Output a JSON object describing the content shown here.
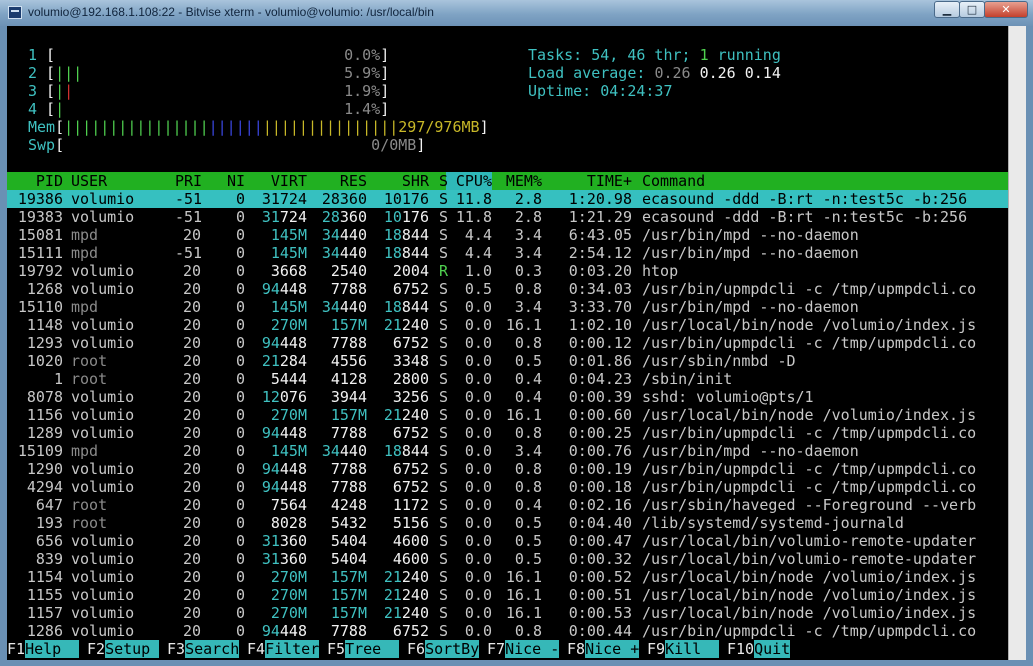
{
  "window": {
    "title": "volumio@192.168.1.108:22 - Bitvise xterm - volumio@volumio: /usr/local/bin",
    "min_label": "▁",
    "max_label": "□",
    "close_label": "✕"
  },
  "meters": {
    "cpus": [
      {
        "num": "1",
        "percent": "0.0%"
      },
      {
        "num": "2",
        "percent": "5.9%"
      },
      {
        "num": "3",
        "percent": "1.9%"
      },
      {
        "num": "4",
        "percent": "1.4%"
      }
    ],
    "mem": {
      "label": "Mem",
      "value": "297/976MB"
    },
    "swp": {
      "label": "Swp",
      "value": "0/0MB"
    }
  },
  "summary": {
    "tasks_label": "Tasks: ",
    "tasks": "54",
    "thr_sep": ", ",
    "threads": "46",
    "thr_label": " thr; ",
    "running": "1",
    "running_label": " running",
    "load_label": "Load average: ",
    "load1": "0.26",
    "load5": "0.26",
    "load15": "0.14",
    "uptime_label": "Uptime: ",
    "uptime": "04:24:37"
  },
  "columns": {
    "pid": "PID",
    "user": "USER",
    "pri": "PRI",
    "ni": "NI",
    "virt": "VIRT",
    "res": "RES",
    "shr": "SHR",
    "s": "S",
    "cpu": "CPU%",
    "mem": "MEM%",
    "time": "TIME+",
    "command": "Command"
  },
  "processes": [
    {
      "pid": "19386",
      "user": "volumio",
      "pri": "-51",
      "ni": "0",
      "virt": "31724",
      "res": "28360",
      "shr": "10176",
      "s": "S",
      "cpu": "11.8",
      "mem": "2.8",
      "time": "1:20.98",
      "cmd": "ecasound -ddd -B:rt -n:test5c -b:256"
    },
    {
      "pid": "19383",
      "user": "volumio",
      "pri": "-51",
      "ni": "0",
      "virt": "31724",
      "res": "28360",
      "shr": "10176",
      "s": "S",
      "cpu": "11.8",
      "mem": "2.8",
      "time": "1:21.29",
      "cmd": "ecasound -ddd -B:rt -n:test5c -b:256"
    },
    {
      "pid": "15081",
      "user": "mpd",
      "pri": "20",
      "ni": "0",
      "virt": "145M",
      "res": "34440",
      "shr": "18844",
      "s": "S",
      "cpu": "4.4",
      "mem": "3.4",
      "time": "6:43.05",
      "cmd": "/usr/bin/mpd --no-daemon"
    },
    {
      "pid": "15111",
      "user": "mpd",
      "pri": "-51",
      "ni": "0",
      "virt": "145M",
      "res": "34440",
      "shr": "18844",
      "s": "S",
      "cpu": "4.4",
      "mem": "3.4",
      "time": "2:54.12",
      "cmd": "/usr/bin/mpd --no-daemon"
    },
    {
      "pid": "19792",
      "user": "volumio",
      "pri": "20",
      "ni": "0",
      "virt": "3668",
      "res": "2540",
      "shr": "2004",
      "s": "R",
      "cpu": "1.0",
      "mem": "0.3",
      "time": "0:03.20",
      "cmd": "htop"
    },
    {
      "pid": "1268",
      "user": "volumio",
      "pri": "20",
      "ni": "0",
      "virt": "94448",
      "res": "7788",
      "shr": "6752",
      "s": "S",
      "cpu": "0.5",
      "mem": "0.8",
      "time": "0:34.03",
      "cmd": "/usr/bin/upmpdcli -c /tmp/upmpdcli.co"
    },
    {
      "pid": "15110",
      "user": "mpd",
      "pri": "20",
      "ni": "0",
      "virt": "145M",
      "res": "34440",
      "shr": "18844",
      "s": "S",
      "cpu": "0.0",
      "mem": "3.4",
      "time": "3:33.70",
      "cmd": "/usr/bin/mpd --no-daemon"
    },
    {
      "pid": "1148",
      "user": "volumio",
      "pri": "20",
      "ni": "0",
      "virt": "270M",
      "res": "157M",
      "shr": "21240",
      "s": "S",
      "cpu": "0.0",
      "mem": "16.1",
      "time": "1:02.10",
      "cmd": "/usr/local/bin/node /volumio/index.js"
    },
    {
      "pid": "1293",
      "user": "volumio",
      "pri": "20",
      "ni": "0",
      "virt": "94448",
      "res": "7788",
      "shr": "6752",
      "s": "S",
      "cpu": "0.0",
      "mem": "0.8",
      "time": "0:00.12",
      "cmd": "/usr/bin/upmpdcli -c /tmp/upmpdcli.co"
    },
    {
      "pid": "1020",
      "user": "root",
      "pri": "20",
      "ni": "0",
      "virt": "21284",
      "res": "4556",
      "shr": "3348",
      "s": "S",
      "cpu": "0.0",
      "mem": "0.5",
      "time": "0:01.86",
      "cmd": "/usr/sbin/nmbd -D"
    },
    {
      "pid": "1",
      "user": "root",
      "pri": "20",
      "ni": "0",
      "virt": "5444",
      "res": "4128",
      "shr": "2800",
      "s": "S",
      "cpu": "0.0",
      "mem": "0.4",
      "time": "0:04.23",
      "cmd": "/sbin/init"
    },
    {
      "pid": "8078",
      "user": "volumio",
      "pri": "20",
      "ni": "0",
      "virt": "12076",
      "res": "3944",
      "shr": "3256",
      "s": "S",
      "cpu": "0.0",
      "mem": "0.4",
      "time": "0:00.39",
      "cmd": "sshd: volumio@pts/1"
    },
    {
      "pid": "1156",
      "user": "volumio",
      "pri": "20",
      "ni": "0",
      "virt": "270M",
      "res": "157M",
      "shr": "21240",
      "s": "S",
      "cpu": "0.0",
      "mem": "16.1",
      "time": "0:00.60",
      "cmd": "/usr/local/bin/node /volumio/index.js"
    },
    {
      "pid": "1289",
      "user": "volumio",
      "pri": "20",
      "ni": "0",
      "virt": "94448",
      "res": "7788",
      "shr": "6752",
      "s": "S",
      "cpu": "0.0",
      "mem": "0.8",
      "time": "0:00.25",
      "cmd": "/usr/bin/upmpdcli -c /tmp/upmpdcli.co"
    },
    {
      "pid": "15109",
      "user": "mpd",
      "pri": "20",
      "ni": "0",
      "virt": "145M",
      "res": "34440",
      "shr": "18844",
      "s": "S",
      "cpu": "0.0",
      "mem": "3.4",
      "time": "0:00.76",
      "cmd": "/usr/bin/mpd --no-daemon"
    },
    {
      "pid": "1290",
      "user": "volumio",
      "pri": "20",
      "ni": "0",
      "virt": "94448",
      "res": "7788",
      "shr": "6752",
      "s": "S",
      "cpu": "0.0",
      "mem": "0.8",
      "time": "0:00.19",
      "cmd": "/usr/bin/upmpdcli -c /tmp/upmpdcli.co"
    },
    {
      "pid": "4294",
      "user": "volumio",
      "pri": "20",
      "ni": "0",
      "virt": "94448",
      "res": "7788",
      "shr": "6752",
      "s": "S",
      "cpu": "0.0",
      "mem": "0.8",
      "time": "0:00.18",
      "cmd": "/usr/bin/upmpdcli -c /tmp/upmpdcli.co"
    },
    {
      "pid": "647",
      "user": "root",
      "pri": "20",
      "ni": "0",
      "virt": "7564",
      "res": "4248",
      "shr": "1172",
      "s": "S",
      "cpu": "0.0",
      "mem": "0.4",
      "time": "0:02.16",
      "cmd": "/usr/sbin/haveged --Foreground --verb"
    },
    {
      "pid": "193",
      "user": "root",
      "pri": "20",
      "ni": "0",
      "virt": "8028",
      "res": "5432",
      "shr": "5156",
      "s": "S",
      "cpu": "0.0",
      "mem": "0.5",
      "time": "0:04.40",
      "cmd": "/lib/systemd/systemd-journald"
    },
    {
      "pid": "656",
      "user": "volumio",
      "pri": "20",
      "ni": "0",
      "virt": "31360",
      "res": "5404",
      "shr": "4600",
      "s": "S",
      "cpu": "0.0",
      "mem": "0.5",
      "time": "0:00.47",
      "cmd": "/usr/local/bin/volumio-remote-updater"
    },
    {
      "pid": "839",
      "user": "volumio",
      "pri": "20",
      "ni": "0",
      "virt": "31360",
      "res": "5404",
      "shr": "4600",
      "s": "S",
      "cpu": "0.0",
      "mem": "0.5",
      "time": "0:00.32",
      "cmd": "/usr/local/bin/volumio-remote-updater"
    },
    {
      "pid": "1154",
      "user": "volumio",
      "pri": "20",
      "ni": "0",
      "virt": "270M",
      "res": "157M",
      "shr": "21240",
      "s": "S",
      "cpu": "0.0",
      "mem": "16.1",
      "time": "0:00.52",
      "cmd": "/usr/local/bin/node /volumio/index.js"
    },
    {
      "pid": "1155",
      "user": "volumio",
      "pri": "20",
      "ni": "0",
      "virt": "270M",
      "res": "157M",
      "shr": "21240",
      "s": "S",
      "cpu": "0.0",
      "mem": "16.1",
      "time": "0:00.51",
      "cmd": "/usr/local/bin/node /volumio/index.js"
    },
    {
      "pid": "1157",
      "user": "volumio",
      "pri": "20",
      "ni": "0",
      "virt": "270M",
      "res": "157M",
      "shr": "21240",
      "s": "S",
      "cpu": "0.0",
      "mem": "16.1",
      "time": "0:00.53",
      "cmd": "/usr/local/bin/node /volumio/index.js"
    },
    {
      "pid": "1286",
      "user": "volumio",
      "pri": "20",
      "ni": "0",
      "virt": "94448",
      "res": "7788",
      "shr": "6752",
      "s": "S",
      "cpu": "0.0",
      "mem": "0.8",
      "time": "0:00.44",
      "cmd": "/usr/bin/upmpdcli -c /tmp/upmpdcli.co"
    }
  ],
  "function_keys": [
    {
      "key": "F1",
      "label": "Help  "
    },
    {
      "key": "F2",
      "label": "Setup "
    },
    {
      "key": "F3",
      "label": "Search"
    },
    {
      "key": "F4",
      "label": "Filter"
    },
    {
      "key": "F5",
      "label": "Tree  "
    },
    {
      "key": "F6",
      "label": "SortBy"
    },
    {
      "key": "F7",
      "label": "Nice -"
    },
    {
      "key": "F8",
      "label": "Nice +"
    },
    {
      "key": "F9",
      "label": "Kill  "
    },
    {
      "key": "F10",
      "label": "Quit"
    }
  ],
  "colors": {
    "cyan": "#3fc1c1",
    "green": "#21b021",
    "selected": "#36c0c0"
  }
}
